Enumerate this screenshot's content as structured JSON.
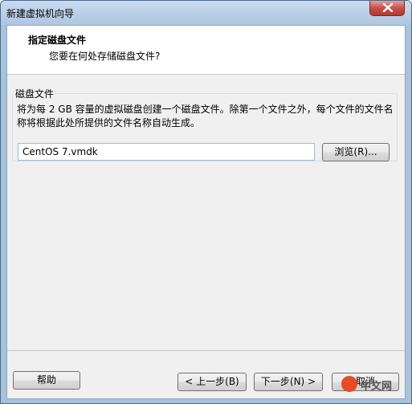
{
  "window": {
    "title": "新建虚拟机向导"
  },
  "header": {
    "title": "指定磁盘文件",
    "subtitle": "您要在何处存储磁盘文件?"
  },
  "disk_file": {
    "group_label": "磁盘文件",
    "description": "将为每 2 GB 容量的虚拟磁盘创建一个磁盘文件。除第一个文件之外，每个文件的文件名称将根据此处所提供的文件名称自动生成。",
    "path_value": "CentOS 7.vmdk",
    "browse_label": "浏览(R)..."
  },
  "footer": {
    "help_label": "帮助",
    "back_label": "< 上一步(B)",
    "next_label": "下一步(N) >",
    "cancel_label": "取消"
  },
  "watermark": {
    "text": "中文网"
  },
  "colors": {
    "close_button": "#c75050",
    "titlebar": "#aec6e0"
  }
}
